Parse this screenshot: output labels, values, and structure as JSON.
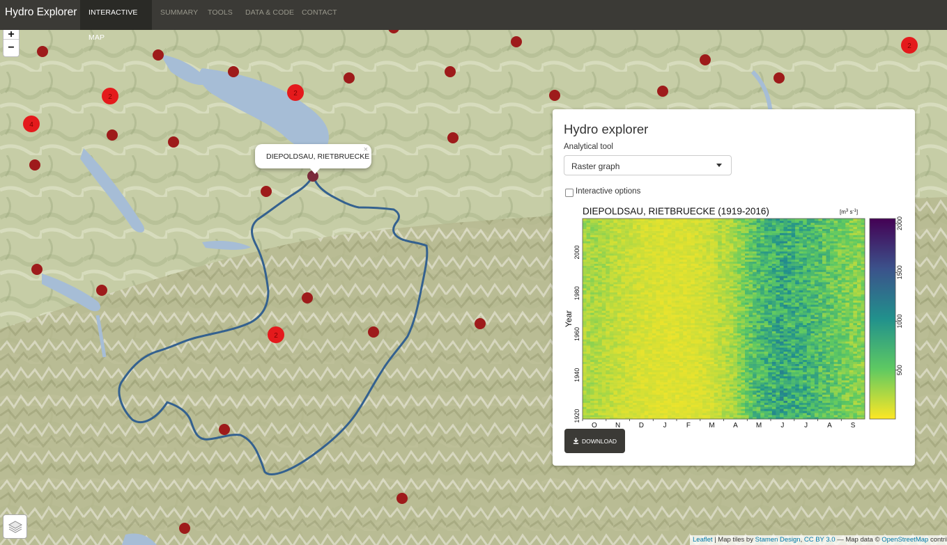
{
  "navbar": {
    "brand": "Hydro Explorer",
    "items": [
      {
        "label": "INTERACTIVE MAP",
        "active": true
      },
      {
        "label": "SUMMARY",
        "active": false
      },
      {
        "label": "TOOLS",
        "active": false
      },
      {
        "label": "DATA & CODE",
        "active": false
      },
      {
        "label": "CONTACT",
        "active": false
      }
    ]
  },
  "map": {
    "zoom_in": "+",
    "zoom_out": "−",
    "layers_icon": "layers-icon",
    "popup": {
      "station": "DIEPOLDSAU, RIETBRUECKE",
      "close": "×"
    },
    "cluster_counts": [
      "2",
      "4",
      "2",
      "2",
      "2"
    ],
    "colors": {
      "marker": "#9e1b1b",
      "cluster": "#e41a1c",
      "catchment": "#34618f",
      "lake": "#a6bdd6",
      "terrain": "#c8cfa8"
    },
    "attribution": {
      "leaflet": "Leaflet",
      "tiles_prefix": " | Map tiles by ",
      "stamen": "Stamen Design",
      "comma": ", ",
      "license": "CC BY 3.0",
      "data_prefix": " — Map data © ",
      "osm": "OpenStreetMap",
      "suffix": " contributors"
    }
  },
  "panel": {
    "title": "Hydro explorer",
    "tool_label": "Analytical tool",
    "tool_value": "Raster graph",
    "interactive_label": "Interactive options",
    "interactive_checked": false,
    "download_label": "DOWNLOAD",
    "download_icon": "download-icon"
  },
  "chart_data": {
    "type": "heatmap",
    "title": "DIEPOLDSAU, RIETBRUECKE (1919-2016)",
    "unit_base": "[m",
    "unit_sup1": "3",
    "unit_mid": " s",
    "unit_sup2": "-1",
    "unit_end": "]",
    "ylabel": "Year",
    "xlabel": "",
    "x_ticks": [
      "O",
      "N",
      "D",
      "J",
      "F",
      "M",
      "A",
      "M",
      "J",
      "J",
      "A",
      "S"
    ],
    "y_ticks": [
      1920,
      1940,
      1960,
      1980,
      2000
    ],
    "y_range": [
      1919,
      2016
    ],
    "colorbar_ticks": [
      500,
      1000,
      1500,
      2000
    ],
    "colorbar_range": [
      0,
      2050
    ],
    "colormap": "viridis (reversed: low=yellow, high=dark purple)",
    "monthly_mean_discharge": [
      {
        "month": "O",
        "value": 230
      },
      {
        "month": "N",
        "value": 160
      },
      {
        "month": "D",
        "value": 110
      },
      {
        "month": "J",
        "value": 90
      },
      {
        "month": "F",
        "value": 95
      },
      {
        "month": "M",
        "value": 130
      },
      {
        "month": "A",
        "value": 300
      },
      {
        "month": "M",
        "value": 650
      },
      {
        "month": "J",
        "value": 800
      },
      {
        "month": "J",
        "value": 700
      },
      {
        "month": "A",
        "value": 550
      },
      {
        "month": "S",
        "value": 380
      }
    ]
  }
}
